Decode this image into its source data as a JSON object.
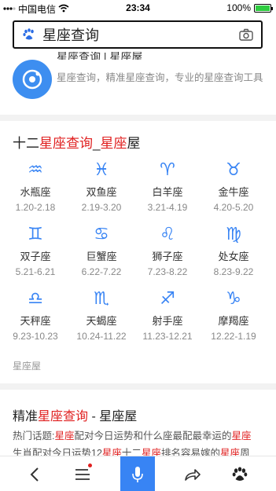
{
  "status_bar": {
    "carrier": "中国电信",
    "time": "23:34",
    "battery_text": "100%",
    "battery_level": 1.0
  },
  "search": {
    "query": "星座查询"
  },
  "top_snippet": {
    "title": "星座查询 | 星座屋",
    "description": "星座查询，精准星座查询，专业的星座查询工具"
  },
  "zodiac_card": {
    "heading_prefix": "十二",
    "heading_red_1": "星座查询",
    "heading_mid": "_",
    "heading_red_2": "星座",
    "heading_suffix": "屋",
    "accent_color": "#3884f4",
    "signs": [
      {
        "glyph": "♒",
        "icon": "aquarius-icon",
        "name": "水瓶座",
        "range": "1.20-2.18"
      },
      {
        "glyph": "♓",
        "icon": "pisces-icon",
        "name": "双鱼座",
        "range": "2.19-3.20"
      },
      {
        "glyph": "♈",
        "icon": "aries-icon",
        "name": "白羊座",
        "range": "3.21-4.19"
      },
      {
        "glyph": "♉",
        "icon": "taurus-icon",
        "name": "金牛座",
        "range": "4.20-5.20"
      },
      {
        "glyph": "♊",
        "icon": "gemini-icon",
        "name": "双子座",
        "range": "5.21-6.21"
      },
      {
        "glyph": "♋",
        "icon": "cancer-icon",
        "name": "巨蟹座",
        "range": "6.22-7.22"
      },
      {
        "glyph": "♌",
        "icon": "leo-icon",
        "name": "狮子座",
        "range": "7.23-8.22"
      },
      {
        "glyph": "♍",
        "icon": "virgo-icon",
        "name": "处女座",
        "range": "8.23-9.22"
      },
      {
        "glyph": "♎",
        "icon": "libra-icon",
        "name": "天秤座",
        "range": "9.23-10.23"
      },
      {
        "glyph": "♏",
        "icon": "scorpio-icon",
        "name": "天蝎座",
        "range": "10.24-11.22"
      },
      {
        "glyph": "♐",
        "icon": "sagittarius-icon",
        "name": "射手座",
        "range": "11.23-12.21"
      },
      {
        "glyph": "♑",
        "icon": "capricorn-icon",
        "name": "摩羯座",
        "range": "12.22-1.19"
      }
    ],
    "source": "星座屋"
  },
  "result2": {
    "title_prefix": "精准",
    "title_red": "星座查询",
    "title_suffix": " - 星座屋",
    "line1_a": "热门话题:",
    "line1_red1": "星座",
    "line1_b": "配对今日运势和什么座最配最幸运的",
    "line1_red2": "星座",
    "line2_a": "生肖配对今日运势12",
    "line2_red1": "星座",
    "line2_b": "十二",
    "line2_red2": "星座",
    "line2_c": "排名容易嫁的",
    "line2_red3": "星座",
    "line2_d": "周"
  },
  "toolbar": {
    "items": [
      "back-icon",
      "menu-icon",
      "voice-icon",
      "share-icon",
      "baidu-paw-icon"
    ]
  }
}
